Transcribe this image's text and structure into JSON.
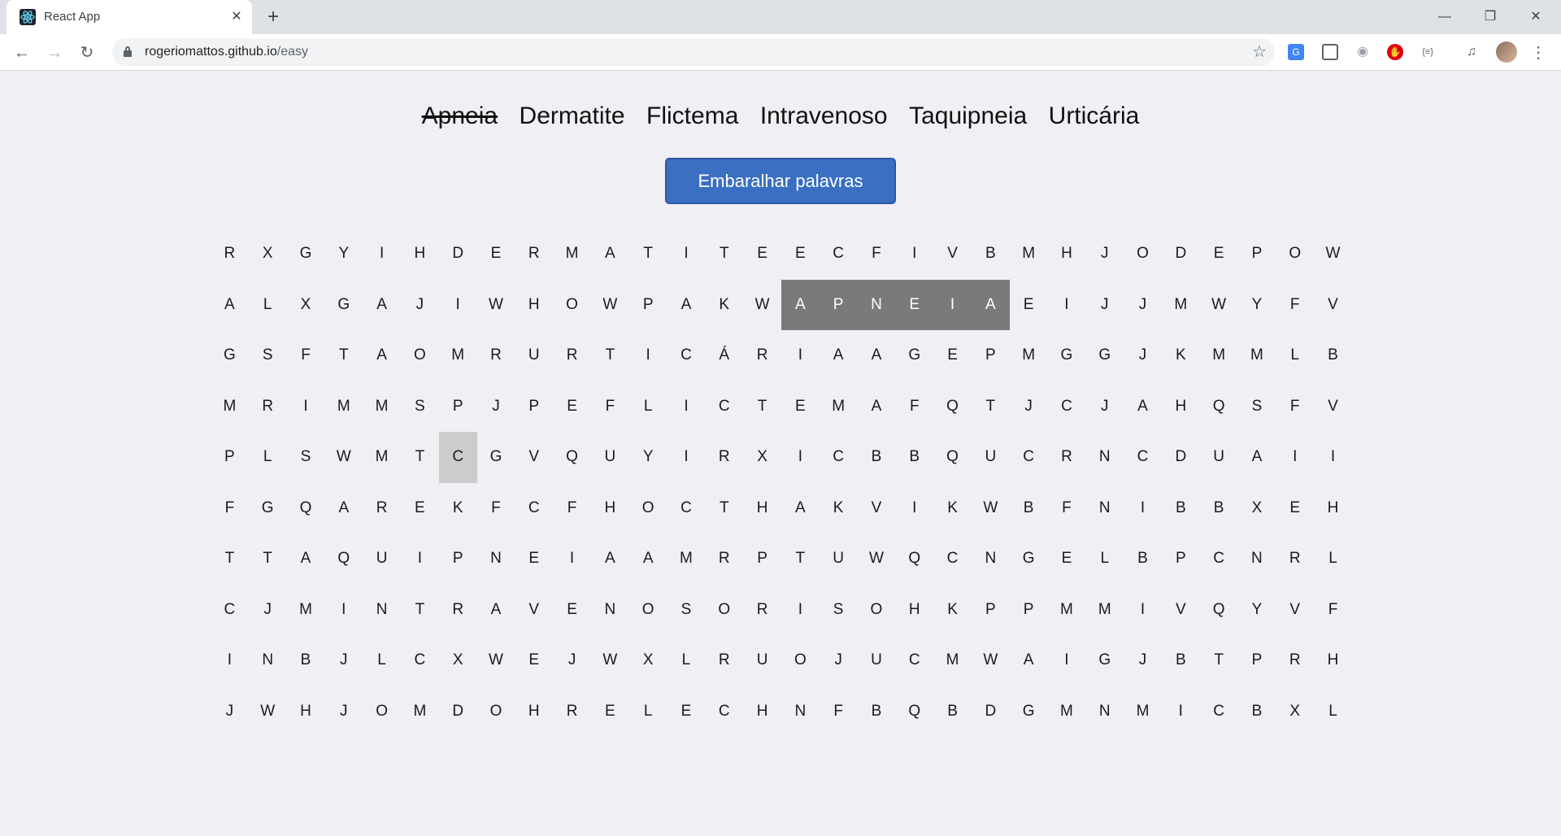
{
  "browser": {
    "tab_title": "React App",
    "url_host": "rogeriomattos.github.io",
    "url_path": "/easy"
  },
  "words": [
    {
      "text": "Apneia",
      "found": true
    },
    {
      "text": "Dermatite",
      "found": false
    },
    {
      "text": "Flictema",
      "found": false
    },
    {
      "text": "Intravenoso",
      "found": false
    },
    {
      "text": "Taquipneia",
      "found": false
    },
    {
      "text": "Urticária",
      "found": false
    }
  ],
  "shuffle_label": "Embaralhar palavras",
  "grid": [
    [
      "R",
      "X",
      "G",
      "Y",
      "I",
      "H",
      "D",
      "E",
      "R",
      "M",
      "A",
      "T",
      "I",
      "T",
      "E",
      "E",
      "C",
      "F",
      "I",
      "V",
      "B",
      "M",
      "H",
      "J",
      "O",
      "D",
      "E",
      "P",
      "O",
      "W"
    ],
    [
      "A",
      "L",
      "X",
      "G",
      "A",
      "J",
      "I",
      "W",
      "H",
      "O",
      "W",
      "P",
      "A",
      "K",
      "W",
      "A",
      "P",
      "N",
      "E",
      "I",
      "A",
      "E",
      "I",
      "J",
      "J",
      "M",
      "W",
      "Y",
      "F",
      "V"
    ],
    [
      "G",
      "S",
      "F",
      "T",
      "A",
      "O",
      "M",
      "R",
      "U",
      "R",
      "T",
      "I",
      "C",
      "Á",
      "R",
      "I",
      "A",
      "A",
      "G",
      "E",
      "P",
      "M",
      "G",
      "G",
      "J",
      "K",
      "M",
      "M",
      "L",
      "B"
    ],
    [
      "M",
      "R",
      "I",
      "M",
      "M",
      "S",
      "P",
      "J",
      "P",
      "E",
      "F",
      "L",
      "I",
      "C",
      "T",
      "E",
      "M",
      "A",
      "F",
      "Q",
      "T",
      "J",
      "C",
      "J",
      "A",
      "H",
      "Q",
      "S",
      "F",
      "V"
    ],
    [
      "P",
      "L",
      "S",
      "W",
      "M",
      "T",
      "C",
      "G",
      "V",
      "Q",
      "U",
      "Y",
      "I",
      "R",
      "X",
      "I",
      "C",
      "B",
      "B",
      "Q",
      "U",
      "C",
      "R",
      "N",
      "C",
      "D",
      "U",
      "A",
      "I",
      "I"
    ],
    [
      "F",
      "G",
      "Q",
      "A",
      "R",
      "E",
      "K",
      "F",
      "C",
      "F",
      "H",
      "O",
      "C",
      "T",
      "H",
      "A",
      "K",
      "V",
      "I",
      "K",
      "W",
      "B",
      "F",
      "N",
      "I",
      "B",
      "B",
      "X",
      "E",
      "H"
    ],
    [
      "T",
      "T",
      "A",
      "Q",
      "U",
      "I",
      "P",
      "N",
      "E",
      "I",
      "A",
      "A",
      "M",
      "R",
      "P",
      "T",
      "U",
      "W",
      "Q",
      "C",
      "N",
      "G",
      "E",
      "L",
      "B",
      "P",
      "C",
      "N",
      "R",
      "L"
    ],
    [
      "C",
      "J",
      "M",
      "I",
      "N",
      "T",
      "R",
      "A",
      "V",
      "E",
      "N",
      "O",
      "S",
      "O",
      "R",
      "I",
      "S",
      "O",
      "H",
      "K",
      "P",
      "P",
      "M",
      "M",
      "I",
      "V",
      "Q",
      "Y",
      "V",
      "F"
    ],
    [
      "I",
      "N",
      "B",
      "J",
      "L",
      "C",
      "X",
      "W",
      "E",
      "J",
      "W",
      "X",
      "L",
      "R",
      "U",
      "O",
      "J",
      "U",
      "C",
      "M",
      "W",
      "A",
      "I",
      "G",
      "J",
      "B",
      "T",
      "P",
      "R",
      "H"
    ],
    [
      "J",
      "W",
      "H",
      "J",
      "O",
      "M",
      "D",
      "O",
      "H",
      "R",
      "E",
      "L",
      "E",
      "C",
      "H",
      "N",
      "F",
      "B",
      "Q",
      "B",
      "D",
      "G",
      "M",
      "N",
      "M",
      "I",
      "C",
      "B",
      "X",
      "L"
    ]
  ],
  "found_cells": [
    [
      1,
      15
    ],
    [
      1,
      16
    ],
    [
      1,
      17
    ],
    [
      1,
      18
    ],
    [
      1,
      19
    ],
    [
      1,
      20
    ]
  ],
  "selected_cells": [
    [
      4,
      6
    ]
  ]
}
